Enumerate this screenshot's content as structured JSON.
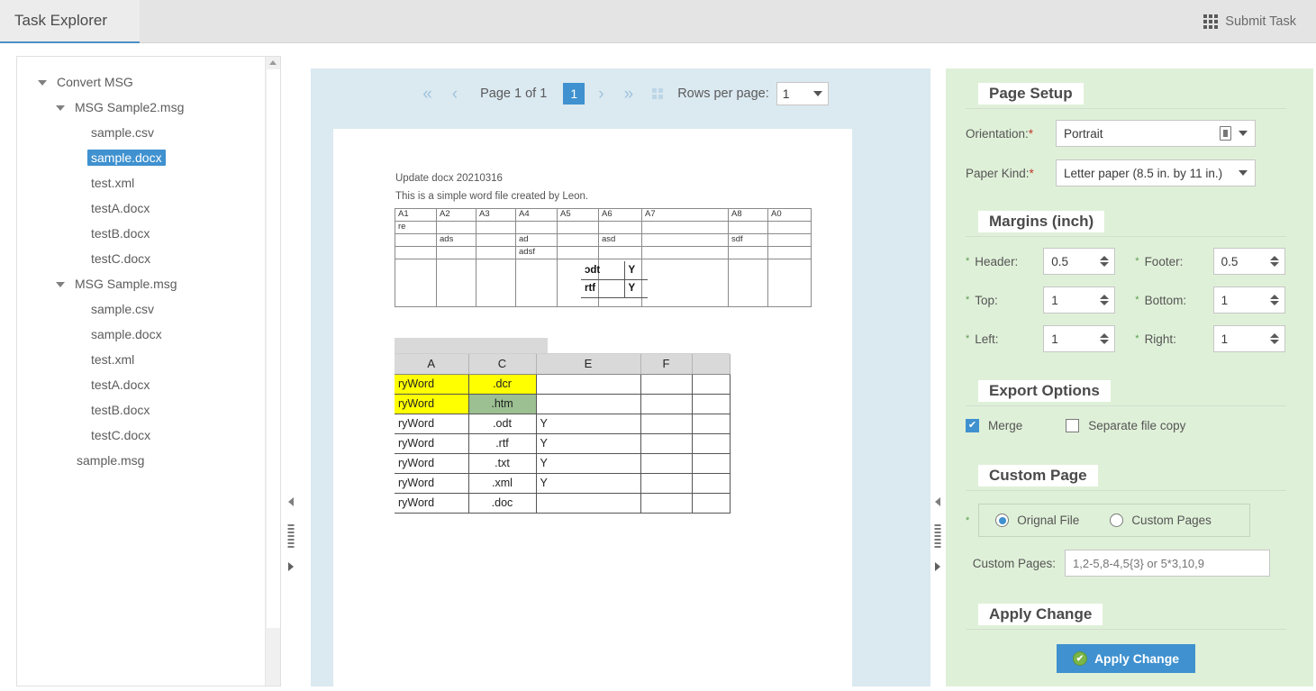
{
  "app": {
    "title": "Task Explorer",
    "submit_label": "Submit Task",
    "submit_icon": "grid-9-icon",
    "accent_color": "#3f91cf",
    "panel_color": "#dff0d8",
    "viewer_bg": "#dbe9f1"
  },
  "sidebar": {
    "nodes": [
      {
        "label": "Convert MSG",
        "level": 0,
        "expanded": true,
        "selected": false
      },
      {
        "label": "MSG Sample2.msg",
        "level": 1,
        "expanded": true,
        "selected": false
      },
      {
        "label": "sample.csv",
        "level": 2,
        "expanded": false,
        "selected": false
      },
      {
        "label": "sample.docx",
        "level": 2,
        "expanded": false,
        "selected": true
      },
      {
        "label": "test.xml",
        "level": 2,
        "expanded": false,
        "selected": false
      },
      {
        "label": "testA.docx",
        "level": 2,
        "expanded": false,
        "selected": false
      },
      {
        "label": "testB.docx",
        "level": 2,
        "expanded": false,
        "selected": false
      },
      {
        "label": "testC.docx",
        "level": 2,
        "expanded": false,
        "selected": false
      },
      {
        "label": "MSG Sample.msg",
        "level": 1,
        "expanded": true,
        "selected": false
      },
      {
        "label": "sample.csv",
        "level": 2,
        "expanded": false,
        "selected": false
      },
      {
        "label": "sample.docx",
        "level": 2,
        "expanded": false,
        "selected": false
      },
      {
        "label": "test.xml",
        "level": 2,
        "expanded": false,
        "selected": false
      },
      {
        "label": "testA.docx",
        "level": 2,
        "expanded": false,
        "selected": false
      },
      {
        "label": "testB.docx",
        "level": 2,
        "expanded": false,
        "selected": false
      },
      {
        "label": "testC.docx",
        "level": 2,
        "expanded": false,
        "selected": false
      },
      {
        "label": "sample.msg",
        "level": 1.5,
        "expanded": false,
        "selected": false
      }
    ]
  },
  "pager": {
    "first": "«",
    "prev": "‹",
    "page_label": "Page 1 of 1",
    "current_page": "1",
    "next": "›",
    "last": "»",
    "grid_icon": "grid-4-icon",
    "rows_label": "Rows per page:",
    "rows_value": "1"
  },
  "document": {
    "line1": "Update docx 20210316",
    "line2": "This is a simple word file created by Leon.",
    "table": {
      "headers": [
        "A1",
        "A2",
        "A3",
        "A4",
        "A5",
        "A6",
        "A7",
        "A8",
        "A0"
      ],
      "rows": [
        [
          "re",
          "",
          "",
          "",
          "",
          "",
          "",
          "",
          ""
        ],
        [
          "",
          "ads",
          "",
          "ad",
          "",
          "asd",
          "",
          "sdf",
          ""
        ],
        [
          "",
          "",
          "",
          "adsf",
          "",
          "",
          "",
          "",
          ""
        ],
        [
          "",
          "",
          "",
          "",
          "",
          "",
          "",
          "",
          ""
        ]
      ]
    },
    "subtable": {
      "rows": [
        [
          "ɔdt",
          "Y"
        ],
        [
          "rtf",
          "Y"
        ]
      ]
    },
    "sheet": {
      "columns": [
        "A",
        "C",
        "E",
        "F"
      ],
      "rows": [
        {
          "a": "ryWord",
          "c": ".dcr",
          "e": "",
          "f": "",
          "highlight": "yellow"
        },
        {
          "a": "ryWord",
          "c": ".htm",
          "e": "",
          "f": "",
          "highlight": "green"
        },
        {
          "a": "ryWord",
          "c": ".odt",
          "e": "Y",
          "f": "",
          "highlight": "none"
        },
        {
          "a": "ryWord",
          "c": ".rtf",
          "e": "Y",
          "f": "",
          "highlight": "none"
        },
        {
          "a": "ryWord",
          "c": ".txt",
          "e": "Y",
          "f": "",
          "highlight": "none"
        },
        {
          "a": "ryWord",
          "c": ".xml",
          "e": "Y",
          "f": "",
          "highlight": "none"
        },
        {
          "a": "ryWord",
          "c": ".doc",
          "e": "",
          "f": "",
          "highlight": "none"
        }
      ]
    }
  },
  "settings": {
    "page_setup": {
      "title": "Page Setup",
      "orientation_label": "Orientation:",
      "orientation_value": "Portrait",
      "paper_label": "Paper Kind:",
      "paper_value": "Letter paper (8.5 in. by 11 in.)"
    },
    "margins": {
      "title": "Margins (inch)",
      "header_label": "Header:",
      "header_value": "0.5",
      "footer_label": "Footer:",
      "footer_value": "0.5",
      "top_label": "Top:",
      "top_value": "1",
      "bottom_label": "Bottom:",
      "bottom_value": "1",
      "left_label": "Left:",
      "left_value": "1",
      "right_label": "Right:",
      "right_value": "1"
    },
    "export_options": {
      "title": "Export Options",
      "merge_label": "Merge",
      "merge_checked": true,
      "separate_label": "Separate file copy",
      "separate_checked": false
    },
    "custom_page": {
      "title": "Custom Page",
      "original_label": "Orignal File",
      "original_selected": true,
      "custom_label": "Custom Pages",
      "custom_selected": false,
      "custom_pages_label": "Custom Pages:",
      "custom_pages_placeholder": "1,2-5,8-4,5{3} or 5*3,10,9",
      "custom_pages_value": ""
    },
    "apply": {
      "title": "Apply Change",
      "button_label": "Apply Change",
      "button_icon": "check-circle-icon"
    }
  }
}
